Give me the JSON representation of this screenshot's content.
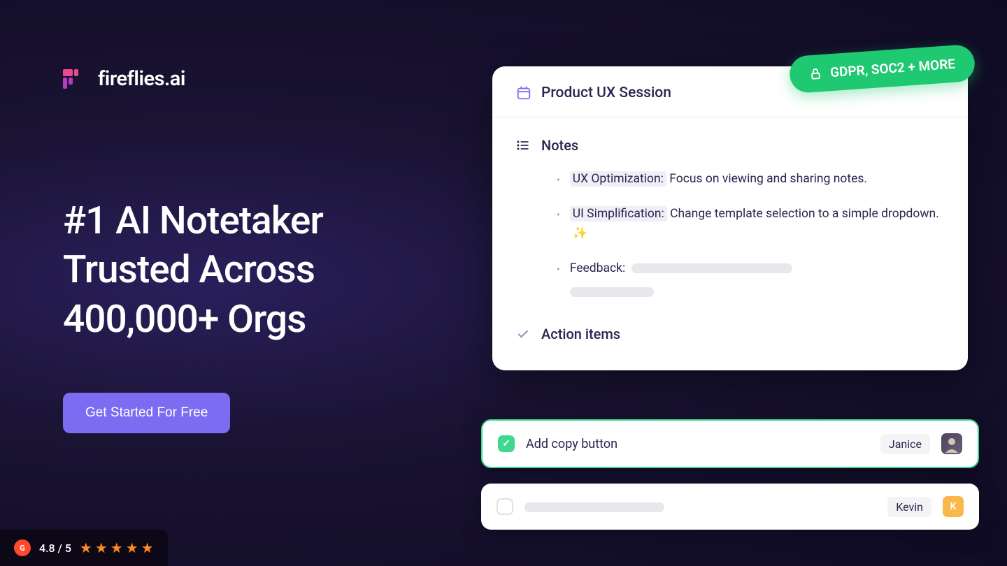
{
  "brand": {
    "name": "fireflies.ai"
  },
  "hero": {
    "headline": "#1 AI Notetaker Trusted Across 400,000+ Orgs",
    "cta_label": "Get Started For Free"
  },
  "rating": {
    "score": "4.8 / 5",
    "stars": 5
  },
  "compliance": {
    "badge_text": "GDPR, SOC2 + MORE"
  },
  "card": {
    "session_title": "Product UX Session",
    "notes_section_title": "Notes",
    "notes": [
      {
        "highlight": "UX Optimization:",
        "text": " Focus on viewing and sharing notes."
      },
      {
        "highlight": "UI Simplification:",
        "text": "  Change template selection to a simple dropdown.  ",
        "sparkle": true
      },
      {
        "highlight": "",
        "text": "Feedback:",
        "skeleton": true
      }
    ],
    "action_items_title": "Action items"
  },
  "action_items": [
    {
      "text": "Add copy button",
      "assignee": "Janice",
      "checked": true,
      "avatar_initial": ""
    },
    {
      "text": "",
      "assignee": "Kevin",
      "checked": false,
      "avatar_initial": "K",
      "skeleton": true
    }
  ]
}
